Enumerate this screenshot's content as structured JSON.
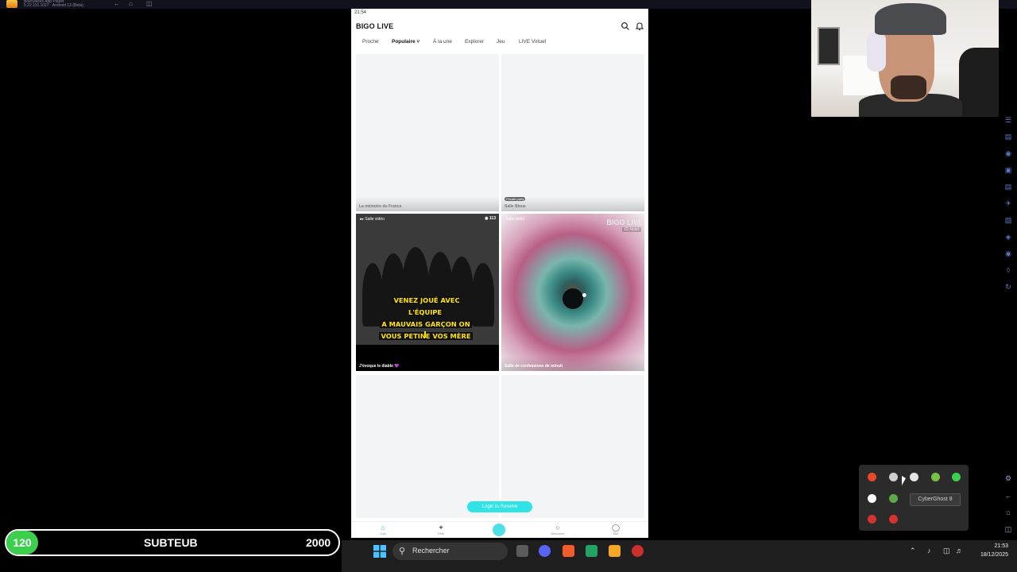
{
  "emulator": {
    "title_line1": "BlueStacks App Player",
    "title_line2": "5.22.110.1027 · Android 13 (Beta)"
  },
  "phone": {
    "status_time": "21:54",
    "app_title": "BIGO LIVE",
    "tabs": [
      "Proche",
      "Populaire ˅",
      "À la une",
      "Explorer",
      "Jeu",
      "LIVE Virtuel"
    ],
    "active_tab": "Populaire",
    "tiles": [
      {
        "caption": "La mémoire du France",
        "top_left": "",
        "top_right": ""
      },
      {
        "caption": "Salle Bleue",
        "badge": "Private party",
        "top_left": "",
        "top_right": ""
      },
      {
        "caption": "J'évoque le diable 💜",
        "top_left": "▸▸ Salle vidéo",
        "top_right": "◉ 113"
      },
      {
        "caption": "Salle de confessions de minuit",
        "top_left": "Salle vidéo",
        "top_right": "",
        "watermark": "BIGO LIVE",
        "watermark_sub": "ID Nutel"
      }
    ],
    "banner_lines": [
      "VENEZ JOUÉ AVEC L'ÉQUIPE",
      "A MAUVAIS GARÇON ON",
      "VOUS PETINE VOS MÈRE"
    ],
    "login_button": "Login to Receive",
    "nav": [
      "Live",
      "Fête",
      "",
      "Découvrir",
      "Moi"
    ]
  },
  "tray_popup": {
    "tooltip": "CyberGhost 8",
    "icon_colors": [
      "#e8492a",
      "#cfcfcf",
      "#e5e5e5",
      "#76c043",
      "#3ccf4e",
      "#ffffff",
      "#5da84a",
      "#d83131",
      "#d83131"
    ]
  },
  "subgoal": {
    "current": "120",
    "label": "SUBTEUB",
    "target": "2000",
    "progress": 0.06,
    "accent": "#3ccf4e"
  },
  "taskbar": {
    "search_placeholder": "Rechercher",
    "time": "21:53",
    "date": "18/12/2025",
    "app_colors": [
      "#5b5b5b",
      "#5865f2",
      "#f25b2b",
      "#21a366",
      "#f5a623",
      "#c9302c"
    ]
  }
}
